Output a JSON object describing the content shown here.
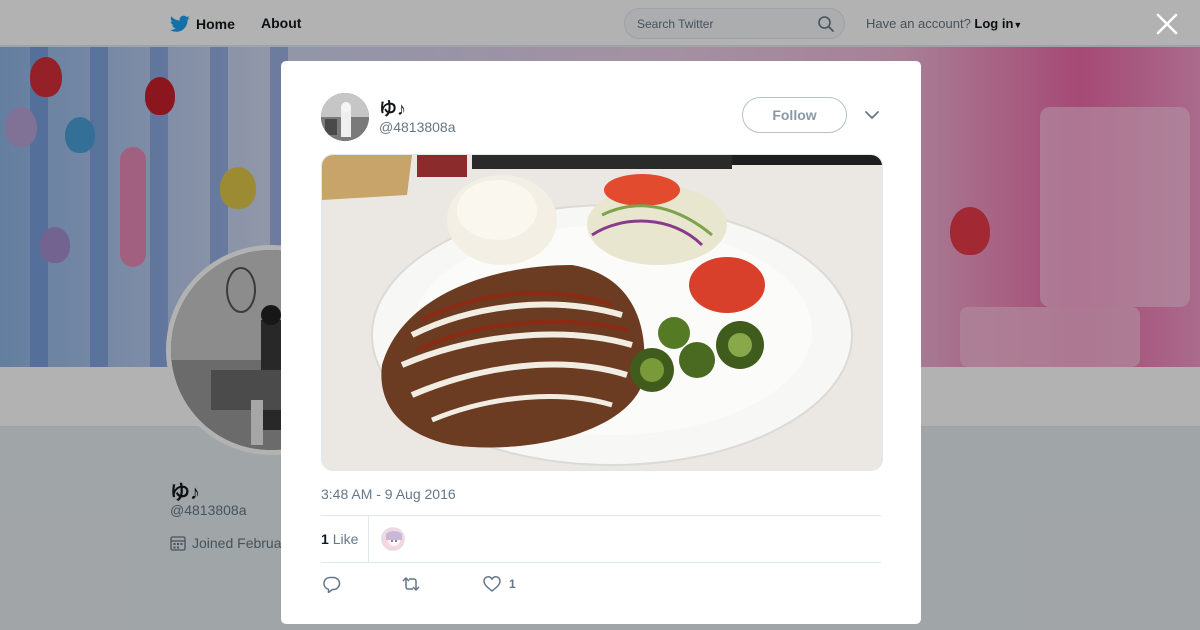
{
  "nav": {
    "home_label": "Home",
    "about_label": "About",
    "search_placeholder": "Search Twitter",
    "account_prompt": "Have an account?",
    "login_label": "Log in"
  },
  "profile": {
    "name": "ゆ♪",
    "handle": "@4813808a",
    "joined_visible": "Joined Februa"
  },
  "tweet": {
    "author_name": "ゆ♪",
    "author_handle": "@4813808a",
    "follow_label": "Follow",
    "timestamp": "3:48 AM - 9 Aug 2016",
    "likes_count": "1",
    "likes_label": "Like",
    "like_action_count": "1"
  },
  "colors": {
    "brand": "#1da1f2",
    "muted": "#657786",
    "border": "#e1e8ed"
  },
  "icons": [
    "twitter-bird-icon",
    "search-icon",
    "caret-down-icon",
    "close-icon",
    "chevron-down-icon",
    "calendar-icon",
    "reply-icon",
    "retweet-icon",
    "heart-icon"
  ]
}
